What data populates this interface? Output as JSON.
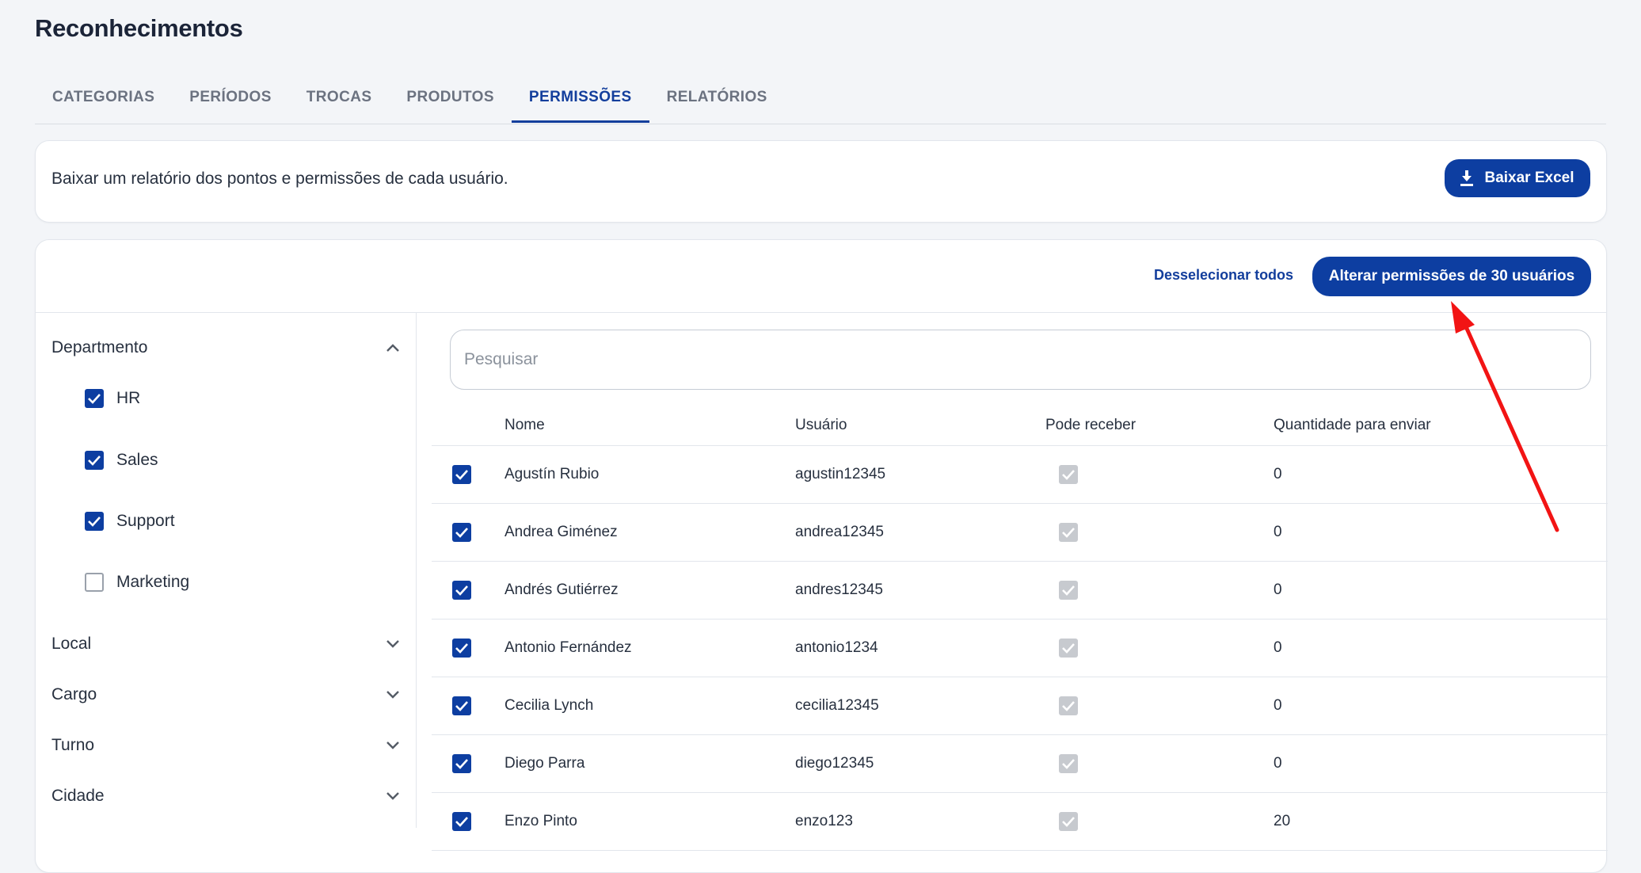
{
  "page": {
    "title": "Reconhecimentos"
  },
  "tabs": [
    {
      "label": "CATEGORIAS"
    },
    {
      "label": "PERÍODOS"
    },
    {
      "label": "TROCAS"
    },
    {
      "label": "PRODUTOS"
    },
    {
      "label": "PERMISSÕES",
      "active": true
    },
    {
      "label": "RELATÓRIOS"
    }
  ],
  "report": {
    "description": "Baixar um relatório dos pontos e permissões de cada usuário.",
    "button": "Baixar Excel"
  },
  "actions": {
    "deselect_all": "Desselecionar todos",
    "change_permissions": "Alterar permissões de 30 usuários"
  },
  "filters": {
    "department": {
      "label": "Departmento",
      "options": [
        {
          "label": "HR",
          "checked": true
        },
        {
          "label": "Sales",
          "checked": true
        },
        {
          "label": "Support",
          "checked": true
        },
        {
          "label": "Marketing",
          "checked": false
        }
      ]
    },
    "local": {
      "label": "Local"
    },
    "cargo": {
      "label": "Cargo"
    },
    "turno": {
      "label": "Turno"
    },
    "cidade": {
      "label": "Cidade"
    }
  },
  "search": {
    "placeholder": "Pesquisar",
    "value": ""
  },
  "table": {
    "headers": {
      "name": "Nome",
      "user": "Usuário",
      "can_receive": "Pode receber",
      "amount": "Quantidade para enviar"
    },
    "rows": [
      {
        "name": "Agustín Rubio",
        "user": "agustin12345",
        "amount": "0"
      },
      {
        "name": "Andrea Giménez",
        "user": "andrea12345",
        "amount": "0"
      },
      {
        "name": "Andrés Gutiérrez",
        "user": "andres12345",
        "amount": "0"
      },
      {
        "name": "Antonio Fernández",
        "user": "antonio1234",
        "amount": "0"
      },
      {
        "name": "Cecilia Lynch",
        "user": "cecilia12345",
        "amount": "0"
      },
      {
        "name": "Diego Parra",
        "user": "diego12345",
        "amount": "0"
      },
      {
        "name": "Enzo Pinto",
        "user": "enzo123",
        "amount": "20"
      }
    ]
  },
  "colors": {
    "primary": "#0d3ea1",
    "annotation_arrow": "#f21414"
  }
}
